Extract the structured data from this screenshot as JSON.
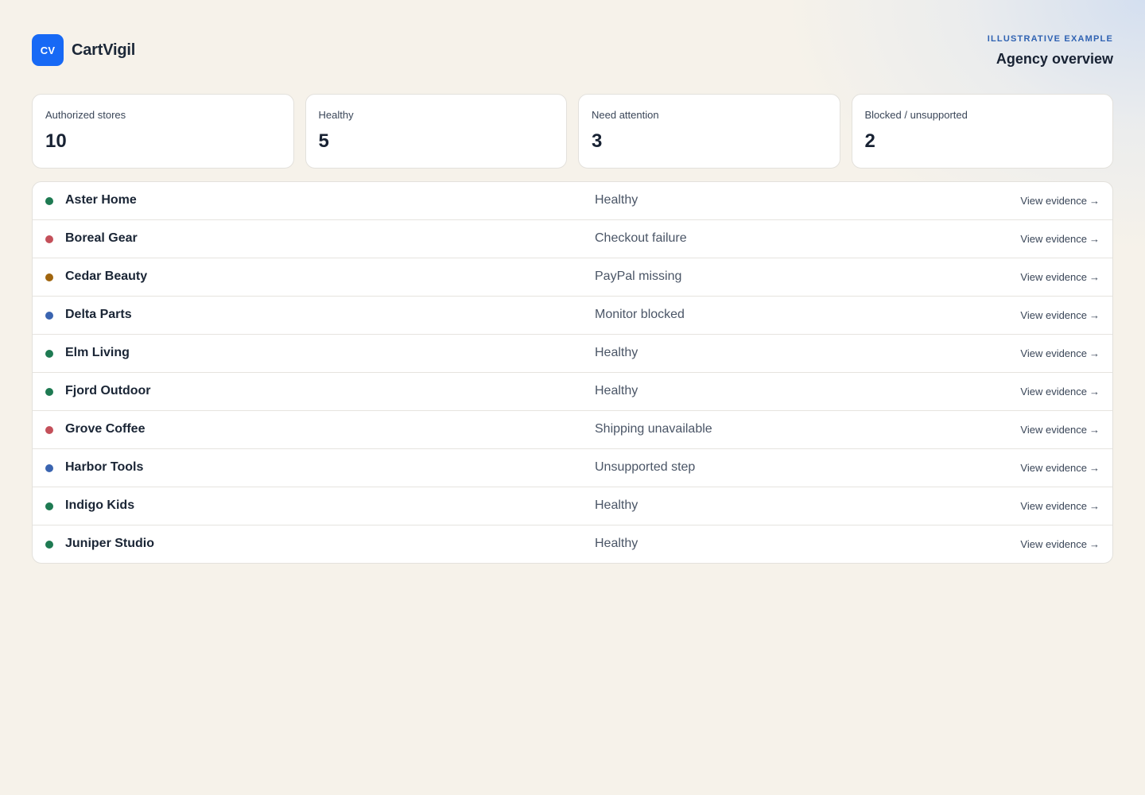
{
  "colors": {
    "accent": "#1769f5",
    "eyebrow": "#2f62b2",
    "healthy": "#1e7a52",
    "failure": "#c4505a",
    "warning": "#a0650e",
    "blocked": "#3a64b0"
  },
  "brand": {
    "logo_text": "CV",
    "name": "CartVigil"
  },
  "header": {
    "eyebrow": "ILLUSTRATIVE EXAMPLE",
    "title": "Agency overview"
  },
  "stats": [
    {
      "label": "Authorized stores",
      "value": "10"
    },
    {
      "label": "Healthy",
      "value": "5"
    },
    {
      "label": "Need attention",
      "value": "3"
    },
    {
      "label": "Blocked / unsupported",
      "value": "2"
    }
  ],
  "stores": [
    {
      "name": "Aster Home",
      "status": "Healthy",
      "indicator": "healthy",
      "link": "View evidence",
      "arrow": "→"
    },
    {
      "name": "Boreal Gear",
      "status": "Checkout failure",
      "indicator": "failure",
      "link": "View evidence",
      "arrow": "→"
    },
    {
      "name": "Cedar Beauty",
      "status": "PayPal missing",
      "indicator": "warning",
      "link": "View evidence",
      "arrow": "→"
    },
    {
      "name": "Delta Parts",
      "status": "Monitor blocked",
      "indicator": "blocked",
      "link": "View evidence",
      "arrow": "→"
    },
    {
      "name": "Elm Living",
      "status": "Healthy",
      "indicator": "healthy",
      "link": "View evidence",
      "arrow": "→"
    },
    {
      "name": "Fjord Outdoor",
      "status": "Healthy",
      "indicator": "healthy",
      "link": "View evidence",
      "arrow": "→"
    },
    {
      "name": "Grove Coffee",
      "status": "Shipping unavailable",
      "indicator": "failure",
      "link": "View evidence",
      "arrow": "→"
    },
    {
      "name": "Harbor Tools",
      "status": "Unsupported step",
      "indicator": "blocked",
      "link": "View evidence",
      "arrow": "→"
    },
    {
      "name": "Indigo Kids",
      "status": "Healthy",
      "indicator": "healthy",
      "link": "View evidence",
      "arrow": "→"
    },
    {
      "name": "Juniper Studio",
      "status": "Healthy",
      "indicator": "healthy",
      "link": "View evidence",
      "arrow": "→"
    }
  ]
}
